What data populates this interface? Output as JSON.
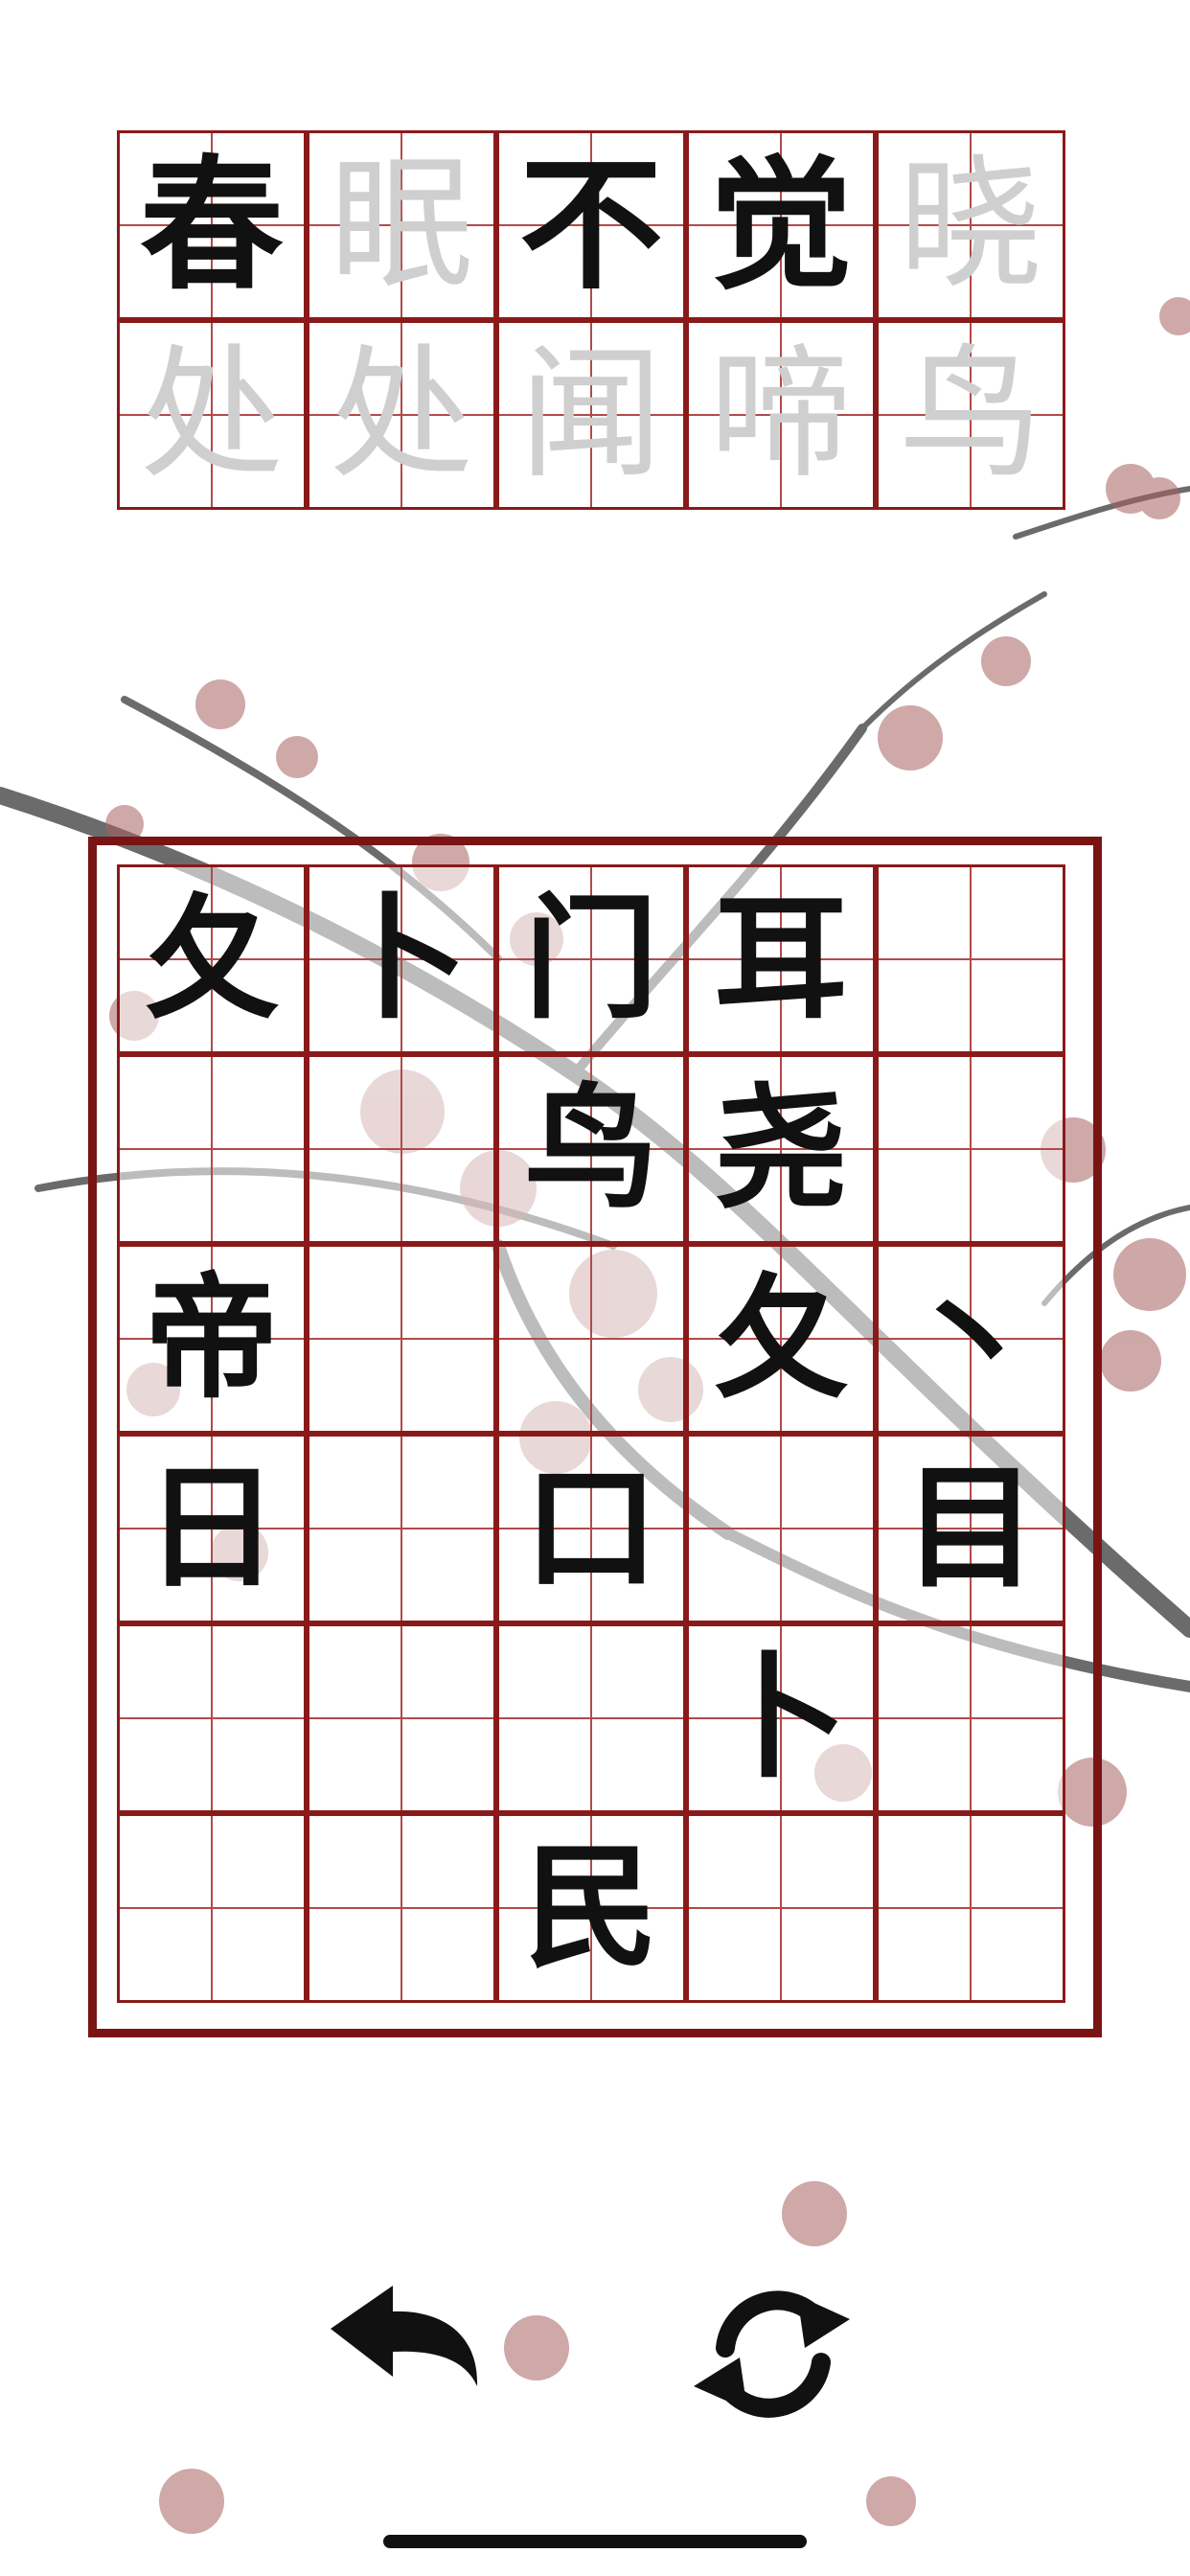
{
  "poem": {
    "line1": [
      {
        "char": "春",
        "revealed": true
      },
      {
        "char": "眠",
        "revealed": false
      },
      {
        "char": "不",
        "revealed": true
      },
      {
        "char": "觉",
        "revealed": true
      },
      {
        "char": "晓",
        "revealed": false
      }
    ],
    "line2": [
      {
        "char": "处",
        "revealed": false
      },
      {
        "char": "处",
        "revealed": false
      },
      {
        "char": "闻",
        "revealed": false
      },
      {
        "char": "啼",
        "revealed": false
      },
      {
        "char": "鸟",
        "revealed": false
      }
    ]
  },
  "board": {
    "rows": [
      [
        "夂",
        "卜",
        "门",
        "耳",
        ""
      ],
      [
        "",
        "",
        "鸟",
        "尧",
        ""
      ],
      [
        "帝",
        "",
        "",
        "夂",
        "丶"
      ],
      [
        "日",
        "",
        "口",
        "",
        "目"
      ],
      [
        "",
        "",
        "",
        "卜",
        ""
      ],
      [
        "",
        "",
        "民",
        "",
        ""
      ]
    ]
  },
  "controls": {
    "undo_icon": "undo-arrow-icon",
    "refresh_icon": "refresh-icon"
  },
  "colors": {
    "grid_border": "#8a1a1a",
    "frame": "#7a1414",
    "revealed_text": "#111111",
    "hidden_text": "#cfcfcf"
  }
}
